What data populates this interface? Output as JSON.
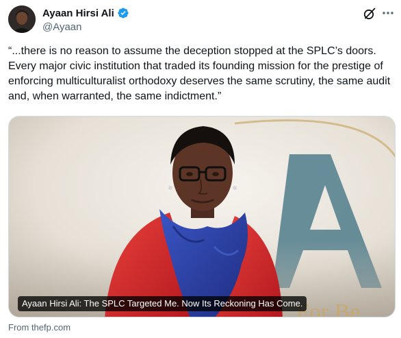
{
  "post": {
    "author": {
      "display_name": "Ayaan Hirsi Ali",
      "handle": "@Ayaan",
      "verified": true
    },
    "text": "“...there is no reason to assume the deception stopped at the SPLC’s doors. Every major civic institution that traded its founding mission for the prestige of enforcing multiculturalist orthodoxy deserves the same scrutiny, the same audit and, when warranted, the same indictment.”",
    "card": {
      "headline": "Ayaan Hirsi Ali: The SPLC Targeted Me. Now Its Reckoning Has Come.",
      "source": "From thefp.com"
    }
  },
  "icons": {
    "verified": "verified-badge-icon",
    "grok": "grok-icon",
    "more": "more-horizontal-icon"
  },
  "colors": {
    "verified_blue": "#1d9bf0",
    "secondary_text": "#536471",
    "jacket_red": "#d92b2b",
    "scarf_blue": "#2a3fa0"
  }
}
